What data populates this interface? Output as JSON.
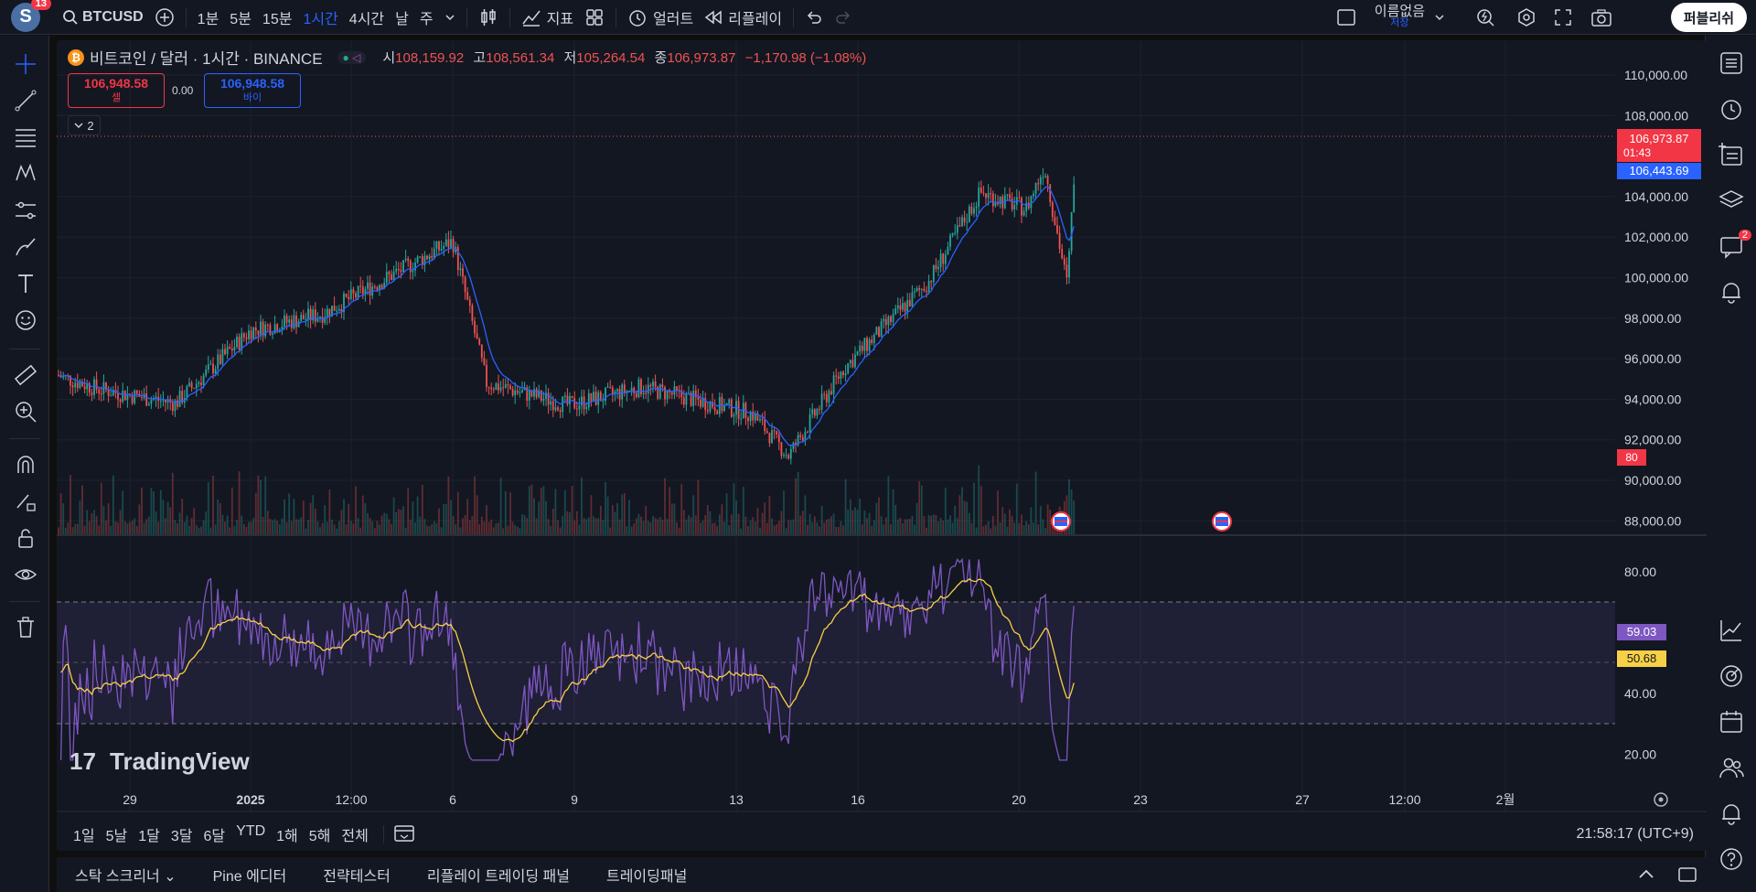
{
  "topbar": {
    "avatar_letter": "S",
    "avatar_badge": "13",
    "symbol": "BTCUSD",
    "timeframes": [
      "1분",
      "5분",
      "15분",
      "1시간",
      "4시간",
      "날",
      "주"
    ],
    "active_timeframe": "1시간",
    "indicators_label": "지표",
    "alert_label": "얼러트",
    "replay_label": "리플레이",
    "layout_name": "이름없음",
    "layout_status": "저장",
    "publish_label": "퍼블리쉬"
  },
  "legend": {
    "title": "비트코인 / 달러 · 1시간 · BINANCE",
    "open_label": "시",
    "open": "108,159.92",
    "high_label": "고",
    "high": "108,561.34",
    "low_label": "저",
    "low": "105,264.54",
    "close_label": "종",
    "close": "106,973.87",
    "change": "−1,170.98 (−1.08%)",
    "sell_price": "106,948.58",
    "sell_label": "셀",
    "spread": "0.00",
    "buy_price": "106,948.58",
    "buy_label": "바이",
    "collapsed_count": "2"
  },
  "price_axis": {
    "labels": [
      "110,000.00",
      "108,000.00",
      "104,000.00",
      "102,000.00",
      "100,000.00",
      "98,000.00",
      "96,000.00",
      "94,000.00",
      "92,000.00",
      "90,000.00",
      "88,000.00"
    ],
    "last_price": "106,973.87",
    "countdown": "01:43",
    "ma_value": "106,443.69",
    "volume_badge": "80"
  },
  "rsi_axis": {
    "labels": [
      "80.00",
      "40.00",
      "20.00"
    ],
    "rsi_value": "59.03",
    "rsi_ma_value": "50.68"
  },
  "time_axis": {
    "labels": [
      "29",
      "2025",
      "12:00",
      "6",
      "9",
      "13",
      "16",
      "20",
      "23",
      "27",
      "12:00",
      "2월"
    ]
  },
  "watermark": "TradingView",
  "ranges": [
    "1일",
    "5날",
    "1달",
    "3달",
    "6달",
    "YTD",
    "1해",
    "5해",
    "전체"
  ],
  "clock": "21:58:17 (UTC+9)",
  "bottom_tabs": [
    "스탁 스크리너",
    "Pine 에디터",
    "전략테스터",
    "리플레이 트레이딩 패널",
    "트레이딩패널"
  ],
  "chat_badge": "2",
  "colors": {
    "background": "#131722",
    "up": "#26a69a",
    "down": "#ef5350",
    "ma_line": "#2962ff",
    "rsi_line": "#7e57c2",
    "rsi_ma_line": "#f7d046"
  },
  "chart_data": {
    "type": "candlestick",
    "symbol": "BTCUSD",
    "interval": "1h",
    "ohlc_last": {
      "open": 108159.92,
      "high": 108561.34,
      "low": 105264.54,
      "close": 106973.87
    },
    "x": [
      "29",
      "2025",
      "12:00",
      "6",
      "9",
      "13",
      "16",
      "20"
    ],
    "approx_close": [
      95200,
      94500,
      93800,
      97400,
      98200,
      101800,
      94800,
      93700,
      94600,
      93300,
      91200,
      95500,
      99800,
      104200,
      103400,
      105500,
      99600,
      106974
    ],
    "ylim": [
      87000,
      110500
    ],
    "rsi": {
      "value": 59.03,
      "ma": 50.68,
      "ylim": [
        10,
        90
      ],
      "bands": [
        30,
        70
      ]
    }
  }
}
